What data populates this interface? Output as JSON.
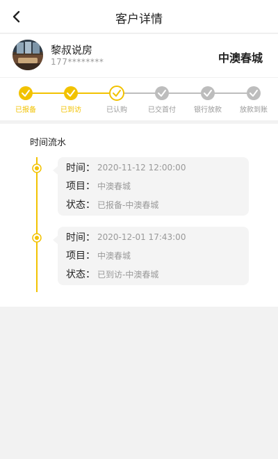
{
  "header": {
    "title": "客户详情"
  },
  "customer": {
    "name": "黎叔说房",
    "phone": "177********",
    "project": "中澳春城"
  },
  "progress": {
    "steps": [
      {
        "label": "已报备",
        "state": "done"
      },
      {
        "label": "已到访",
        "state": "done"
      },
      {
        "label": "已认购",
        "state": "current"
      },
      {
        "label": "已交首付",
        "state": "pending"
      },
      {
        "label": "银行放款",
        "state": "pending"
      },
      {
        "label": "放款到账",
        "state": "pending"
      }
    ]
  },
  "timeline": {
    "title": "时间流水",
    "keys": {
      "time": "时间：",
      "project": "项目：",
      "status": "状态："
    },
    "entries": [
      {
        "time": "2020-11-12 12:00:00",
        "project": "中澳春城",
        "status": "已报备-中澳春城"
      },
      {
        "time": "2020-12-01 17:43:00",
        "project": "中澳春城",
        "status": "已到访-中澳春城"
      }
    ]
  },
  "colors": {
    "accent": "#f2c200",
    "pending": "#bdbdbd",
    "text_muted": "#999999"
  }
}
